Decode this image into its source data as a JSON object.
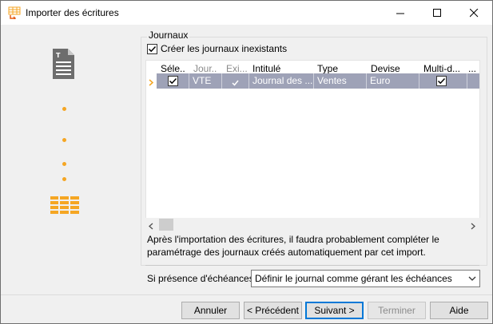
{
  "window": {
    "title": "Importer des écritures",
    "controls": [
      "minimize-icon",
      "maximize-icon",
      "close-icon"
    ]
  },
  "sidebar": {
    "icons": [
      "document-icon",
      "table-icon"
    ],
    "accent_color": "#f5a623"
  },
  "journaux": {
    "group_title": "Journaux",
    "create_checkbox_label": "Créer les journaux inexistants",
    "create_checked": true,
    "columns": [
      "Séle...",
      "Jour...",
      "Exi...",
      "Intitulé",
      "Type",
      "Devise",
      "Multi-d...",
      "..."
    ],
    "rows": [
      {
        "selected": true,
        "journal": "VTE",
        "exists": true,
        "intitule": "Journal des ...",
        "type": "Ventes",
        "devise": "Euro",
        "multi": true
      }
    ]
  },
  "info_text_line1": "Après l'importation des écritures, il faudra probablement compléter le",
  "info_text_line2": "paramétrage des journaux créés automatiquement par cet import.",
  "echeances": {
    "label": "Si présence d'échéances",
    "selected_option": "Définir le journal comme gérant les échéances"
  },
  "buttons": {
    "annuler": "Annuler",
    "precedent": "< Précédent",
    "suivant": "Suivant >",
    "terminer": "Terminer",
    "aide": "Aide"
  }
}
